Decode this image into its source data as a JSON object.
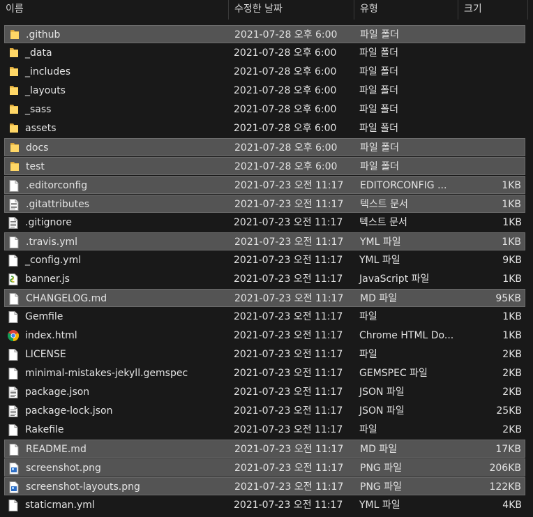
{
  "columns": {
    "name": "이름",
    "date": "수정한 날짜",
    "type": "유형",
    "size": "크기"
  },
  "colors": {
    "background": "#191919",
    "selected_row": "#545454",
    "folder_yellow": "#f3c44e"
  },
  "files": [
    {
      "name": ".github",
      "date": "2021-07-28 오후 6:00",
      "type": "파일 폴더",
      "size": "",
      "icon": "folder-icon",
      "selected": true
    },
    {
      "name": "_data",
      "date": "2021-07-28 오후 6:00",
      "type": "파일 폴더",
      "size": "",
      "icon": "folder-icon",
      "selected": false
    },
    {
      "name": "_includes",
      "date": "2021-07-28 오후 6:00",
      "type": "파일 폴더",
      "size": "",
      "icon": "folder-icon",
      "selected": false
    },
    {
      "name": "_layouts",
      "date": "2021-07-28 오후 6:00",
      "type": "파일 폴더",
      "size": "",
      "icon": "folder-icon",
      "selected": false
    },
    {
      "name": "_sass",
      "date": "2021-07-28 오후 6:00",
      "type": "파일 폴더",
      "size": "",
      "icon": "folder-icon",
      "selected": false
    },
    {
      "name": "assets",
      "date": "2021-07-28 오후 6:00",
      "type": "파일 폴더",
      "size": "",
      "icon": "folder-icon",
      "selected": false
    },
    {
      "name": "docs",
      "date": "2021-07-28 오후 6:00",
      "type": "파일 폴더",
      "size": "",
      "icon": "folder-icon",
      "selected": true
    },
    {
      "name": "test",
      "date": "2021-07-28 오후 6:00",
      "type": "파일 폴더",
      "size": "",
      "icon": "folder-icon",
      "selected": true
    },
    {
      "name": ".editorconfig",
      "date": "2021-07-23 오전 11:17",
      "type": "EDITORCONFIG ...",
      "size": "1KB",
      "icon": "blank-file-icon",
      "selected": true
    },
    {
      "name": ".gitattributes",
      "date": "2021-07-23 오전 11:17",
      "type": "텍스트 문서",
      "size": "1KB",
      "icon": "text-file-icon",
      "selected": true
    },
    {
      "name": ".gitignore",
      "date": "2021-07-23 오전 11:17",
      "type": "텍스트 문서",
      "size": "1KB",
      "icon": "text-file-icon",
      "selected": false
    },
    {
      "name": ".travis.yml",
      "date": "2021-07-23 오전 11:17",
      "type": "YML 파일",
      "size": "1KB",
      "icon": "blank-file-icon",
      "selected": true
    },
    {
      "name": "_config.yml",
      "date": "2021-07-23 오전 11:17",
      "type": "YML 파일",
      "size": "9KB",
      "icon": "blank-file-icon",
      "selected": false
    },
    {
      "name": "banner.js",
      "date": "2021-07-23 오전 11:17",
      "type": "JavaScript 파일",
      "size": "1KB",
      "icon": "javascript-file-icon",
      "selected": false
    },
    {
      "name": "CHANGELOG.md",
      "date": "2021-07-23 오전 11:17",
      "type": "MD 파일",
      "size": "95KB",
      "icon": "blank-file-icon",
      "selected": true
    },
    {
      "name": "Gemfile",
      "date": "2021-07-23 오전 11:17",
      "type": "파일",
      "size": "1KB",
      "icon": "blank-file-icon",
      "selected": false
    },
    {
      "name": "index.html",
      "date": "2021-07-23 오전 11:17",
      "type": "Chrome HTML Do...",
      "size": "1KB",
      "icon": "chrome-icon",
      "selected": false
    },
    {
      "name": "LICENSE",
      "date": "2021-07-23 오전 11:17",
      "type": "파일",
      "size": "2KB",
      "icon": "blank-file-icon",
      "selected": false
    },
    {
      "name": "minimal-mistakes-jekyll.gemspec",
      "date": "2021-07-23 오전 11:17",
      "type": "GEMSPEC 파일",
      "size": "2KB",
      "icon": "blank-file-icon",
      "selected": false
    },
    {
      "name": "package.json",
      "date": "2021-07-23 오전 11:17",
      "type": "JSON 파일",
      "size": "2KB",
      "icon": "text-file-icon",
      "selected": false
    },
    {
      "name": "package-lock.json",
      "date": "2021-07-23 오전 11:17",
      "type": "JSON 파일",
      "size": "25KB",
      "icon": "text-file-icon",
      "selected": false
    },
    {
      "name": "Rakefile",
      "date": "2021-07-23 오전 11:17",
      "type": "파일",
      "size": "2KB",
      "icon": "blank-file-icon",
      "selected": false
    },
    {
      "name": "README.md",
      "date": "2021-07-23 오전 11:17",
      "type": "MD 파일",
      "size": "17KB",
      "icon": "blank-file-icon",
      "selected": true
    },
    {
      "name": "screenshot.png",
      "date": "2021-07-23 오전 11:17",
      "type": "PNG 파일",
      "size": "206KB",
      "icon": "image-file-icon",
      "selected": true
    },
    {
      "name": "screenshot-layouts.png",
      "date": "2021-07-23 오전 11:17",
      "type": "PNG 파일",
      "size": "122KB",
      "icon": "image-file-icon",
      "selected": true
    },
    {
      "name": "staticman.yml",
      "date": "2021-07-23 오전 11:17",
      "type": "YML 파일",
      "size": "4KB",
      "icon": "blank-file-icon",
      "selected": false
    }
  ]
}
